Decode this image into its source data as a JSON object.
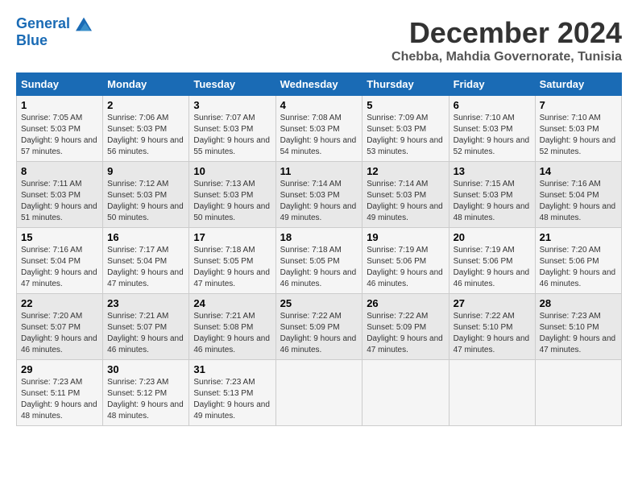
{
  "header": {
    "logo_line1": "General",
    "logo_line2": "Blue",
    "month_title": "December 2024",
    "subtitle": "Chebba, Mahdia Governorate, Tunisia"
  },
  "weekdays": [
    "Sunday",
    "Monday",
    "Tuesday",
    "Wednesday",
    "Thursday",
    "Friday",
    "Saturday"
  ],
  "weeks": [
    [
      {
        "day": "1",
        "sunrise": "7:05 AM",
        "sunset": "5:03 PM",
        "daylight": "9 hours and 57 minutes."
      },
      {
        "day": "2",
        "sunrise": "7:06 AM",
        "sunset": "5:03 PM",
        "daylight": "9 hours and 56 minutes."
      },
      {
        "day": "3",
        "sunrise": "7:07 AM",
        "sunset": "5:03 PM",
        "daylight": "9 hours and 55 minutes."
      },
      {
        "day": "4",
        "sunrise": "7:08 AM",
        "sunset": "5:03 PM",
        "daylight": "9 hours and 54 minutes."
      },
      {
        "day": "5",
        "sunrise": "7:09 AM",
        "sunset": "5:03 PM",
        "daylight": "9 hours and 53 minutes."
      },
      {
        "day": "6",
        "sunrise": "7:10 AM",
        "sunset": "5:03 PM",
        "daylight": "9 hours and 52 minutes."
      },
      {
        "day": "7",
        "sunrise": "7:10 AM",
        "sunset": "5:03 PM",
        "daylight": "9 hours and 52 minutes."
      }
    ],
    [
      {
        "day": "8",
        "sunrise": "7:11 AM",
        "sunset": "5:03 PM",
        "daylight": "9 hours and 51 minutes."
      },
      {
        "day": "9",
        "sunrise": "7:12 AM",
        "sunset": "5:03 PM",
        "daylight": "9 hours and 50 minutes."
      },
      {
        "day": "10",
        "sunrise": "7:13 AM",
        "sunset": "5:03 PM",
        "daylight": "9 hours and 50 minutes."
      },
      {
        "day": "11",
        "sunrise": "7:14 AM",
        "sunset": "5:03 PM",
        "daylight": "9 hours and 49 minutes."
      },
      {
        "day": "12",
        "sunrise": "7:14 AM",
        "sunset": "5:03 PM",
        "daylight": "9 hours and 49 minutes."
      },
      {
        "day": "13",
        "sunrise": "7:15 AM",
        "sunset": "5:03 PM",
        "daylight": "9 hours and 48 minutes."
      },
      {
        "day": "14",
        "sunrise": "7:16 AM",
        "sunset": "5:04 PM",
        "daylight": "9 hours and 48 minutes."
      }
    ],
    [
      {
        "day": "15",
        "sunrise": "7:16 AM",
        "sunset": "5:04 PM",
        "daylight": "9 hours and 47 minutes."
      },
      {
        "day": "16",
        "sunrise": "7:17 AM",
        "sunset": "5:04 PM",
        "daylight": "9 hours and 47 minutes."
      },
      {
        "day": "17",
        "sunrise": "7:18 AM",
        "sunset": "5:05 PM",
        "daylight": "9 hours and 47 minutes."
      },
      {
        "day": "18",
        "sunrise": "7:18 AM",
        "sunset": "5:05 PM",
        "daylight": "9 hours and 46 minutes."
      },
      {
        "day": "19",
        "sunrise": "7:19 AM",
        "sunset": "5:06 PM",
        "daylight": "9 hours and 46 minutes."
      },
      {
        "day": "20",
        "sunrise": "7:19 AM",
        "sunset": "5:06 PM",
        "daylight": "9 hours and 46 minutes."
      },
      {
        "day": "21",
        "sunrise": "7:20 AM",
        "sunset": "5:06 PM",
        "daylight": "9 hours and 46 minutes."
      }
    ],
    [
      {
        "day": "22",
        "sunrise": "7:20 AM",
        "sunset": "5:07 PM",
        "daylight": "9 hours and 46 minutes."
      },
      {
        "day": "23",
        "sunrise": "7:21 AM",
        "sunset": "5:07 PM",
        "daylight": "9 hours and 46 minutes."
      },
      {
        "day": "24",
        "sunrise": "7:21 AM",
        "sunset": "5:08 PM",
        "daylight": "9 hours and 46 minutes."
      },
      {
        "day": "25",
        "sunrise": "7:22 AM",
        "sunset": "5:09 PM",
        "daylight": "9 hours and 46 minutes."
      },
      {
        "day": "26",
        "sunrise": "7:22 AM",
        "sunset": "5:09 PM",
        "daylight": "9 hours and 47 minutes."
      },
      {
        "day": "27",
        "sunrise": "7:22 AM",
        "sunset": "5:10 PM",
        "daylight": "9 hours and 47 minutes."
      },
      {
        "day": "28",
        "sunrise": "7:23 AM",
        "sunset": "5:10 PM",
        "daylight": "9 hours and 47 minutes."
      }
    ],
    [
      {
        "day": "29",
        "sunrise": "7:23 AM",
        "sunset": "5:11 PM",
        "daylight": "9 hours and 48 minutes."
      },
      {
        "day": "30",
        "sunrise": "7:23 AM",
        "sunset": "5:12 PM",
        "daylight": "9 hours and 48 minutes."
      },
      {
        "day": "31",
        "sunrise": "7:23 AM",
        "sunset": "5:13 PM",
        "daylight": "9 hours and 49 minutes."
      },
      null,
      null,
      null,
      null
    ]
  ]
}
